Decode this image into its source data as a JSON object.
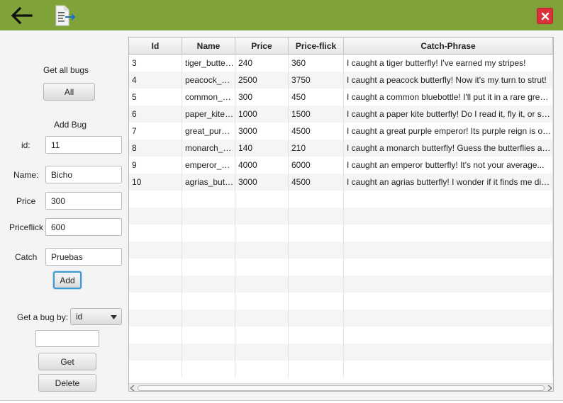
{
  "toolbar": {
    "back_icon": "arrow-left-icon",
    "doc_icon": "document-export-icon",
    "close_icon": "close-icon",
    "accent": "#7fa33a",
    "close_color": "#d9323a"
  },
  "form": {
    "get_all_label": "Get all bugs",
    "all_button": "All",
    "add_bug_label": "Add Bug",
    "id_label": "id:",
    "id_value": "11",
    "name_label": "Name:",
    "name_value": "Bicho",
    "price_label": "Price",
    "price_value": "300",
    "priceflick_label": "Priceflick",
    "priceflick_value": "600",
    "catch_label": "Catch",
    "catch_value": "Pruebas",
    "add_button": "Add",
    "get_by_label": "Get a bug by:",
    "get_by_selected": "id",
    "get_by_value": "",
    "get_button": "Get",
    "delete_button": "Delete"
  },
  "table": {
    "columns": [
      "Id",
      "Name",
      "Price",
      "Price-flick",
      "Catch-Phrase"
    ],
    "rows": [
      [
        "3",
        "tiger_butterfly",
        "240",
        "360",
        "I caught a tiger butterfly! I've earned my stripes!"
      ],
      [
        "4",
        "peacock_butterfly",
        "2500",
        "3750",
        "I caught a peacock butterfly! Now it's my turn to strut!"
      ],
      [
        "5",
        "common_bluebottle",
        "300",
        "450",
        "I caught a common bluebottle! I'll put it in a rare green bottle!"
      ],
      [
        "6",
        "paper_kite_butterfly",
        "1000",
        "1500",
        "I caught a paper kite butterfly! Do I read it, fly it, or say..."
      ],
      [
        "7",
        "great_purple_emperor",
        "3000",
        "4500",
        "I caught a great purple emperor! Its purple reign is over!"
      ],
      [
        "8",
        "monarch_butterfly",
        "140",
        "210",
        "I caught a monarch butterfly! Guess the butterflies are..."
      ],
      [
        "9",
        "emperor_butterfly",
        "4000",
        "6000",
        "I caught an emperor butterfly! It's not your average..."
      ],
      [
        "10",
        "agrias_butterfly",
        "3000",
        "4500",
        "I caught an agrias butterfly! I wonder if it finds me dizzy..."
      ]
    ],
    "empty_rows": 11
  }
}
